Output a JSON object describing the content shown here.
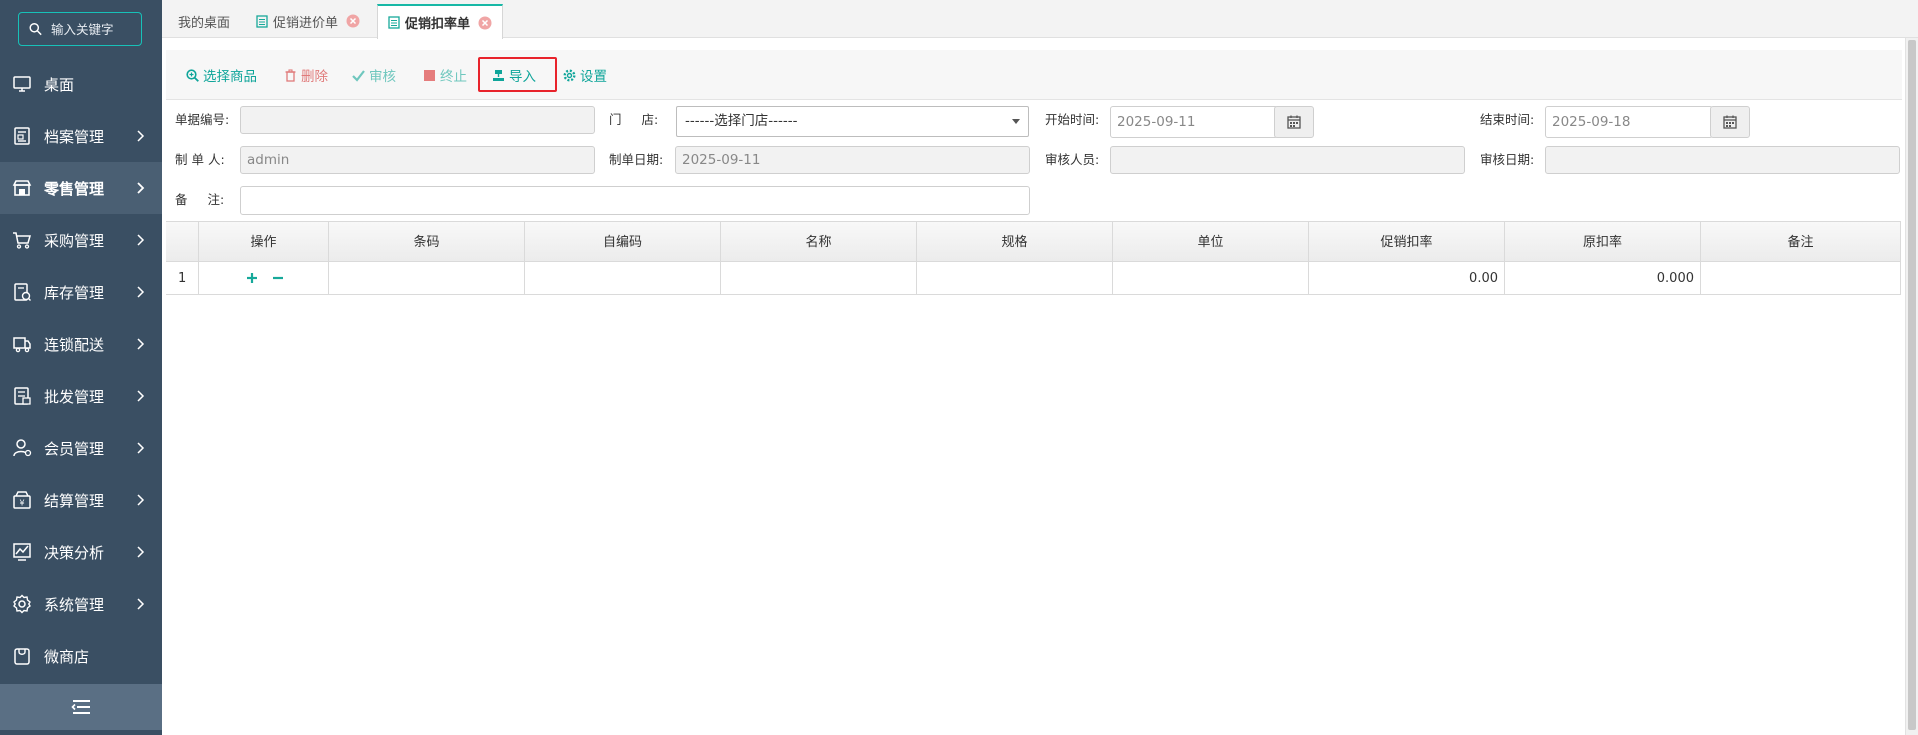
{
  "sidebar": {
    "search_placeholder": "输入关键字",
    "items": [
      {
        "label": "桌面",
        "icon": "monitor-icon"
      },
      {
        "label": "档案管理",
        "icon": "archive-icon"
      },
      {
        "label": "零售管理",
        "icon": "store-icon"
      },
      {
        "label": "采购管理",
        "icon": "cart-icon"
      },
      {
        "label": "库存管理",
        "icon": "warehouse-icon"
      },
      {
        "label": "连锁配送",
        "icon": "truck-icon"
      },
      {
        "label": "批发管理",
        "icon": "wholesale-icon"
      },
      {
        "label": "会员管理",
        "icon": "member-icon"
      },
      {
        "label": "结算管理",
        "icon": "wallet-icon"
      },
      {
        "label": "决策分析",
        "icon": "chart-icon"
      },
      {
        "label": "系统管理",
        "icon": "gear-icon"
      },
      {
        "label": "微商店",
        "icon": "shop-bag-icon"
      }
    ]
  },
  "tabs": [
    {
      "label": "我的桌面"
    },
    {
      "label": "促销进价单"
    },
    {
      "label": "促销扣率单"
    }
  ],
  "toolbar": {
    "select_goods": "选择商品",
    "delete": "删除",
    "audit": "审核",
    "terminate": "终止",
    "import": "导入",
    "settings": "设置"
  },
  "form": {
    "doc_no_label": "单据编号:",
    "doc_no_value": "",
    "store_label_1": "门",
    "store_label_2": "店:",
    "store_value": "------选择门店------",
    "start_label": "开始时间:",
    "start_value": "2025-09-11",
    "end_label": "结束时间:",
    "end_value": "2025-09-18",
    "maker_label": "制 单 人:",
    "maker_value": "admin",
    "make_date_label": "制单日期:",
    "make_date_value": "2025-09-11",
    "auditor_label": "审核人员:",
    "auditor_value": "",
    "audit_date_label": "审核日期:",
    "audit_date_value": "",
    "remark_label_1": "备",
    "remark_label_2": "注:",
    "remark_value": ""
  },
  "table": {
    "columns": [
      "操作",
      "条码",
      "自编码",
      "名称",
      "规格",
      "单位",
      "促销扣率",
      "原扣率",
      "备注"
    ],
    "rows": [
      {
        "index": "1",
        "barcode": "",
        "code": "",
        "name": "",
        "spec": "",
        "unit": "",
        "promo_rate": "0.00",
        "orig_rate": "0.000",
        "remark": ""
      }
    ]
  },
  "colors": {
    "sidebar_bg": "#3a4f63",
    "accent": "#17b8a6",
    "highlight": "#e8232b"
  }
}
